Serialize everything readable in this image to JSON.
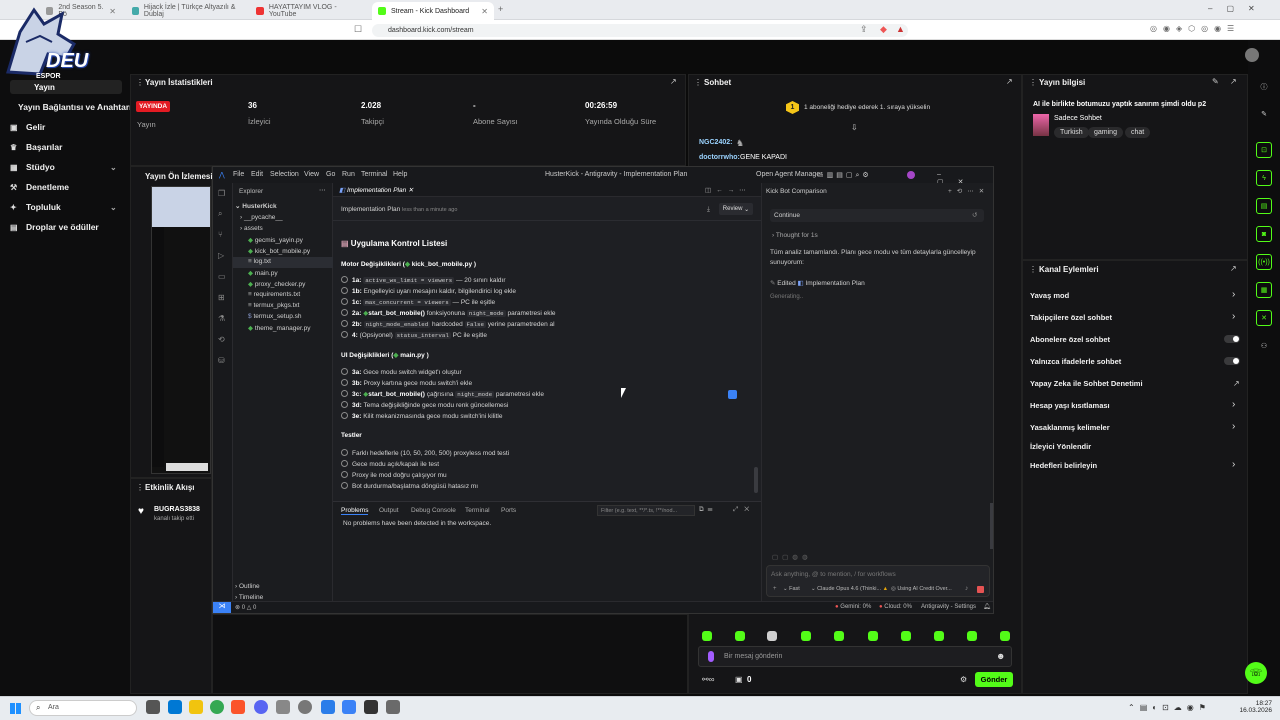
{
  "browser": {
    "tabs": [
      {
        "label": "2nd Season 5. Bö"
      },
      {
        "label": "Hijack İzle | Türkçe Altyazılı & Dublaj"
      },
      {
        "label": "HAYATTAYIM VLOG - YouTube"
      },
      {
        "label": "Stream - Kick Dashboard"
      }
    ],
    "url": "dashboard.kick.com/stream"
  },
  "logo": {
    "text": "DEU",
    "sub": "ESPOR"
  },
  "sidebar": {
    "top_label": "Yayın",
    "items": [
      {
        "label": "Yayın Bağlantısı ve Anahtarı"
      },
      {
        "label": "Gelir"
      },
      {
        "label": "Başarılar"
      },
      {
        "label": "Stüdyo"
      },
      {
        "label": "Denetleme"
      },
      {
        "label": "Topluluk"
      },
      {
        "label": "Droplar ve ödüller"
      }
    ]
  },
  "stats": {
    "title": "Yayın İstatistikleri",
    "live_badge": "YAYINDA",
    "live_label": "Yayın",
    "viewers_value": "36",
    "viewers_label": "İzleyici",
    "followers_value": "2.028",
    "followers_label": "Takipçi",
    "subs_value": "-",
    "subs_label": "Abone Sayısı",
    "duration_value": "00:26:59",
    "duration_label": "Yayında Olduğu Süre"
  },
  "preview": {
    "title": "Yayın Ön İzlemesi"
  },
  "activity": {
    "title": "Etkinlik Akışı",
    "user": "BUGRAS3838",
    "event": "kanalı takip etti"
  },
  "chat": {
    "title": "Sohbet",
    "pinned_rank": "1",
    "pinned": "1 aboneliği hediye ederek 1. sıraya yükselin",
    "messages": [
      {
        "user": "NGC2402:",
        "text": ""
      },
      {
        "user": "doctorrwho:",
        "text": "GENE KAPADI"
      }
    ],
    "input_placeholder": "Bir mesaj gönderin",
    "points": "0",
    "send": "Gönder"
  },
  "stream_info": {
    "title": "Yayın bilgisi",
    "stream_title": "AI ile birlikte botumuzu yaptık sanırım şimdi oldu p2",
    "category": "Sadece Sohbet",
    "tags": [
      "Turkish",
      "gaming",
      "chat"
    ]
  },
  "channel_actions": {
    "title": "Kanal Eylemleri",
    "items": [
      {
        "label": "Yavaş mod",
        "control": "chevron"
      },
      {
        "label": "Takipçilere özel sohbet",
        "control": "chevron"
      },
      {
        "label": "Abonelere özel sohbet",
        "control": "toggle"
      },
      {
        "label": "Yalnızca ifadelerle sohbet",
        "control": "toggle"
      },
      {
        "label": "Yapay Zeka ile Sohbet Denetimi",
        "control": "external"
      },
      {
        "label": "Hesap yaşı kısıtlaması",
        "control": "chevron"
      },
      {
        "label": "Yasaklanmış kelimeler",
        "control": "chevron"
      },
      {
        "label": "İzleyici Yönlendir",
        "control": "none"
      },
      {
        "label": "Hedefleri belirleyin",
        "control": "chevron"
      }
    ]
  },
  "ide": {
    "menu": [
      "File",
      "Edit",
      "Selection",
      "View",
      "Go",
      "Run",
      "Terminal",
      "Help"
    ],
    "title": "HusterKick - Antigravity - Implementation Plan",
    "agent_manager": "Open Agent Manager",
    "explorer": {
      "title": "Explorer",
      "root": "HusterKick",
      "items": [
        "__pycache__",
        "assets",
        "gecmis_yayin.py",
        "kick_bot_mobile.py",
        "log.txt",
        "main.py",
        "proxy_checker.py",
        "requirements.txt",
        "termux_pkgs.txt",
        "termux_setup.sh",
        "theme_manager.py"
      ],
      "outline": "Outline",
      "timeline": "Timeline"
    },
    "editor": {
      "tab": "Implementation Plan",
      "header": "Implementation Plan",
      "header_meta": "less than a minute ago",
      "review": "Review",
      "heading": "Uygulama Kontrol Listesi",
      "motor_title": "Motor Değişiklikleri (",
      "motor_file": "kick_bot_mobile.py",
      "motor_items": [
        {
          "id": "1a:",
          "code": "active_ws_limit = viewers",
          "rest": "— 20 sınırı kaldır"
        },
        {
          "id": "1b:",
          "code": "",
          "rest": "Engelleyici uyarı mesajını kaldır, bilgilendirici log ekle"
        },
        {
          "id": "1c:",
          "code": "max_concurrent = viewers",
          "rest": "— PC ile eşitle"
        },
        {
          "id": "2a:",
          "code": "",
          "fn": "start_bot_mobile()",
          "rest": "fonksiyonuna",
          "code2": "night_mode",
          "rest2": "parametresi ekle"
        },
        {
          "id": "2b:",
          "code": "night_mode_enabled",
          "rest": "hardcoded",
          "code2": "False",
          "rest2": "yerine parametreden al"
        },
        {
          "id": "4:",
          "code": "",
          "rest": "(Opsiyonel)",
          "code2": "status_interval",
          "rest2": "PC ile eşitle"
        }
      ],
      "ui_title": "UI Değişiklikleri (",
      "ui_file": "main.py",
      "ui_items": [
        {
          "id": "3a:",
          "rest": "Gece modu switch widget'ı oluştur"
        },
        {
          "id": "3b:",
          "rest": "Proxy kartına gece modu switch'i ekle"
        },
        {
          "id": "3c:",
          "fn": "start_bot_mobile()",
          "rest": "çağrısına",
          "code2": "night_mode",
          "rest2": "parametresi ekle"
        },
        {
          "id": "3d:",
          "rest": "Tema değişikliğinde gece modu renk güncellemesi"
        },
        {
          "id": "3e:",
          "rest": "Kilit mekanizmasında gece modu switch'ini kilitle"
        }
      ],
      "tests_title": "Testler",
      "tests": [
        "Farklı hedeflerle (10, 50, 200, 500) proxyless mod testi",
        "Gece modu açık/kapalı ile test",
        "Proxy ile mod doğru çalışıyor mu",
        "Bot durdurma/başlatma döngüsü hatasız mı"
      ]
    },
    "panel": {
      "tabs": [
        "Problems",
        "Output",
        "Debug Console",
        "Terminal",
        "Ports"
      ],
      "filter": "Filter (e.g. text, **/*.ts, !**/nod...",
      "message": "No problems have been detected in the workspace."
    },
    "agent": {
      "title": "Kick Bot Comparison",
      "continue": "Continue",
      "thought": "Thought for 1s",
      "summary": "Tüm analiz tamamlandı. Planı gece modu ve tüm detaylarla güncelleyip sunuyorum:",
      "edited": "Edited",
      "edited_file": "Implementation Plan",
      "generating": "Generating..",
      "input_placeholder": "Ask anything, @ to mention, / for workflows",
      "mode": "Fast",
      "model": "Claude Opus 4.6 (Thinki...",
      "credit": "Using AI Credit Over..."
    },
    "status": {
      "errors": "0",
      "warnings": "0",
      "gemini": "Gemini: 0%",
      "cloud": "Cloud: 0%",
      "settings": "Antigravity - Settings"
    }
  },
  "taskbar": {
    "search": "Ara",
    "time": "18:27",
    "date": "16.03.2026"
  },
  "colors": {
    "kick_green": "#53fc18",
    "live_red": "#e31b23",
    "bg": "#0b0b0b"
  }
}
